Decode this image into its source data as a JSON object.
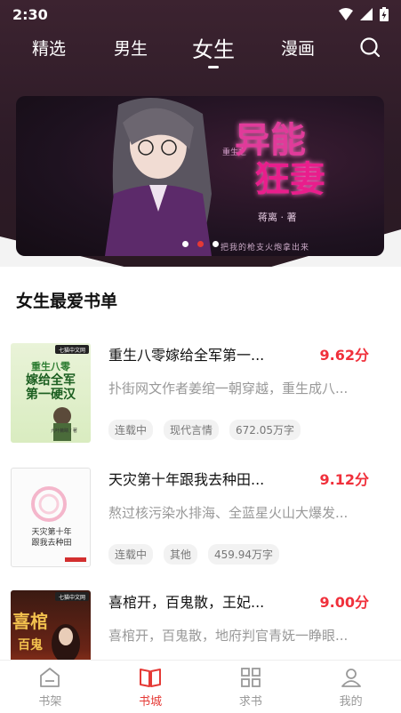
{
  "status": {
    "time": "2:30"
  },
  "tabs": [
    {
      "label": "精选",
      "active": false
    },
    {
      "label": "男生",
      "active": false
    },
    {
      "label": "女生",
      "active": true
    },
    {
      "label": "漫画",
      "active": false
    }
  ],
  "banner": {
    "small_text": "重生之",
    "title_line1": "异能",
    "title_line2": "狂妻",
    "author": "蒋离 · 著",
    "subtitle": "把我的枪支火炮拿出来",
    "dots": 3,
    "active_dot": 1
  },
  "section": {
    "title": "女生最爱书单",
    "books": [
      {
        "title": "重生八零嫁给全军第一...",
        "score": "9.62分",
        "desc": "扑街网文作者姜绾一朝穿越，重生成八...",
        "tags": [
          "连载中",
          "现代言情",
          "672.05万字"
        ],
        "cover_lines": [
          "七猫中文网",
          "重生八零",
          "嫁给全军",
          "第一硬汉",
          "九叶薇睛 / 著"
        ]
      },
      {
        "title": "天灾第十年跟我去种田...",
        "score": "9.12分",
        "desc": "熬过核污染水排海、全蓝星火山大爆发...",
        "tags": [
          "连载中",
          "其他",
          "459.94万字"
        ],
        "cover_lines": [
          "天灾第十年",
          "跟我去种田"
        ]
      },
      {
        "title": "喜棺开，百鬼散，王妃...",
        "score": "9.00分",
        "desc": "喜棺开，百鬼散，地府判官青妩一睁眼...",
        "tags": [],
        "cover_lines": [
          "七猫中文网",
          "喜棺",
          "百鬼"
        ]
      }
    ]
  },
  "bottom_nav": [
    {
      "label": "书架",
      "icon": "bookshelf-icon",
      "active": false
    },
    {
      "label": "书城",
      "icon": "book-open-icon",
      "active": true
    },
    {
      "label": "求书",
      "icon": "grid-icon",
      "active": false
    },
    {
      "label": "我的",
      "icon": "user-icon",
      "active": false
    }
  ],
  "colors": {
    "accent": "#e53935",
    "score": "#f0303b",
    "hero_bg": "#2d1b27"
  }
}
